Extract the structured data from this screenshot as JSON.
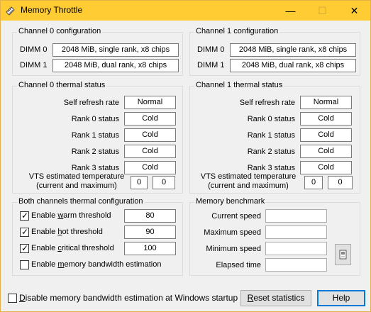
{
  "window": {
    "title": "Memory Throttle",
    "minimize": "—",
    "maximize": "☐",
    "close": "✕"
  },
  "ch0cfg": {
    "title": "Channel 0 configuration",
    "dimm0_label": "DIMM 0",
    "dimm0_value": "2048 MiB, single rank, x8 chips",
    "dimm1_label": "DIMM 1",
    "dimm1_value": "2048 MiB, dual rank, x8 chips"
  },
  "ch1cfg": {
    "title": "Channel 1 configuration",
    "dimm0_label": "DIMM 0",
    "dimm0_value": "2048 MiB, single rank, x8 chips",
    "dimm1_label": "DIMM 1",
    "dimm1_value": "2048 MiB, dual rank, x8 chips"
  },
  "ch0therm": {
    "title": "Channel 0 thermal status",
    "rows": [
      {
        "label": "Self refresh rate",
        "value": "Normal"
      },
      {
        "label": "Rank 0 status",
        "value": "Cold"
      },
      {
        "label": "Rank 1 status",
        "value": "Cold"
      },
      {
        "label": "Rank 2 status",
        "value": "Cold"
      },
      {
        "label": "Rank 3 status",
        "value": "Cold"
      }
    ],
    "vts_line1": "VTS estimated temperature",
    "vts_line2": "(current and maximum)",
    "vts_current": "0",
    "vts_max": "0"
  },
  "ch1therm": {
    "title": "Channel 1 thermal status",
    "rows": [
      {
        "label": "Self refresh rate",
        "value": "Normal"
      },
      {
        "label": "Rank 0 status",
        "value": "Cold"
      },
      {
        "label": "Rank 1 status",
        "value": "Cold"
      },
      {
        "label": "Rank 2 status",
        "value": "Cold"
      },
      {
        "label": "Rank 3 status",
        "value": "Cold"
      }
    ],
    "vts_line1": "VTS estimated temperature",
    "vts_line2": "(current and maximum)",
    "vts_current": "0",
    "vts_max": "0"
  },
  "thermcfg": {
    "title": "Both channels thermal configuration",
    "warm_pre": "Enable ",
    "warm_u": "w",
    "warm_post": "arm threshold",
    "warm_value": "80",
    "warm_checked": true,
    "hot_pre": "Enable ",
    "hot_u": "h",
    "hot_post": "ot threshold",
    "hot_value": "90",
    "hot_checked": true,
    "crit_pre": "Enable ",
    "crit_u": "c",
    "crit_post": "ritical threshold",
    "crit_value": "100",
    "crit_checked": true,
    "bw_pre": "Enable ",
    "bw_u": "m",
    "bw_post": "emory bandwidth estimation",
    "bw_checked": false
  },
  "bench": {
    "title": "Memory benchmark",
    "current_label": "Current speed",
    "current_value": "",
    "max_label": "Maximum speed",
    "max_value": "",
    "min_label": "Minimum speed",
    "min_value": "",
    "elapsed_label": "Elapsed time",
    "elapsed_value": "",
    "run_icon": "memory-chip-icon"
  },
  "footer": {
    "disable_u": "D",
    "disable_post": "isable memory bandwidth estimation at Windows startup",
    "disable_checked": false,
    "reset_u": "R",
    "reset_post": "eset statistics",
    "help": "Help"
  },
  "colors": {
    "titlebar": "#ffcc33",
    "default_button_border": "#0078d7"
  }
}
